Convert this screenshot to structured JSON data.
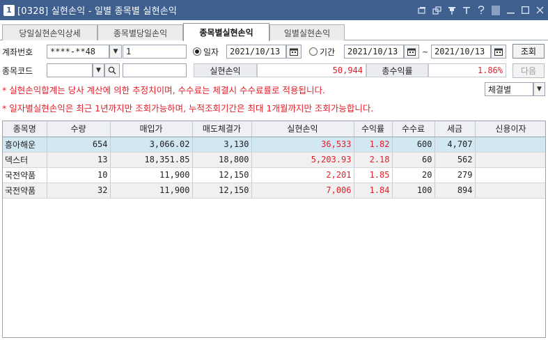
{
  "window": {
    "number": "1",
    "title": "[0328] 실현손익 - 일별 종목별 실현손익",
    "icons": [
      "restore-icon",
      "popout-icon",
      "pin-icon",
      "font-icon",
      "help-icon",
      "minimize-icon",
      "maximize-icon",
      "close-icon"
    ]
  },
  "tabs": [
    {
      "label": "당일실현손익상세",
      "active": false
    },
    {
      "label": "종목별당일손익",
      "active": false
    },
    {
      "label": "종목별실현손익",
      "active": true
    },
    {
      "label": "일별실현손익",
      "active": false
    }
  ],
  "account": {
    "label": "계좌번호",
    "value": "****-**48",
    "sub_value": "1"
  },
  "period": {
    "daily_label": "일자",
    "daily_date": "2021/10/13",
    "range_label": "기간",
    "range_start": "2021/10/13",
    "range_sep": "~",
    "range_end": "2021/10/13",
    "selected": "daily"
  },
  "buttons": {
    "query": "조회",
    "next": "다음"
  },
  "stock_code": {
    "label": "종목코드",
    "value": "",
    "name": ""
  },
  "summary": {
    "realized_label": "실현손익",
    "realized_value": "50,944",
    "return_label": "총수익률",
    "return_value": "1.86%"
  },
  "notes": [
    "* 실현손익합계는 당사 계산에 의한 추정치이며, 수수료는 체결시 수수료률로 적용됩니다.",
    "* 일자별실현손익은 최근 1년까지만 조회가능하며, 누적조회기간은 최대 1개월까지만 조회가능합니다."
  ],
  "filter": {
    "selected": "체결별"
  },
  "table": {
    "columns": [
      "종목명",
      "수량",
      "매입가",
      "매도체결가",
      "실현손익",
      "수익률",
      "수수료",
      "세금",
      "신용이자"
    ],
    "rows": [
      [
        "흥아해운",
        "654",
        "3,066.02",
        "3,130",
        "36,533",
        "1.82",
        "600",
        "4,707",
        ""
      ],
      [
        "덱스터",
        "13",
        "18,351.85",
        "18,800",
        "5,203.93",
        "2.18",
        "60",
        "562",
        ""
      ],
      [
        "국전약품",
        "10",
        "11,900",
        "12,150",
        "2,201",
        "1.85",
        "20",
        "279",
        ""
      ],
      [
        "국전약품",
        "32",
        "11,900",
        "12,150",
        "7,006",
        "1.84",
        "100",
        "894",
        ""
      ]
    ]
  },
  "colors": {
    "titlebar": "#3f5f8f",
    "profit_red": "#e2202a",
    "selected_row": "#d1e7f2"
  }
}
